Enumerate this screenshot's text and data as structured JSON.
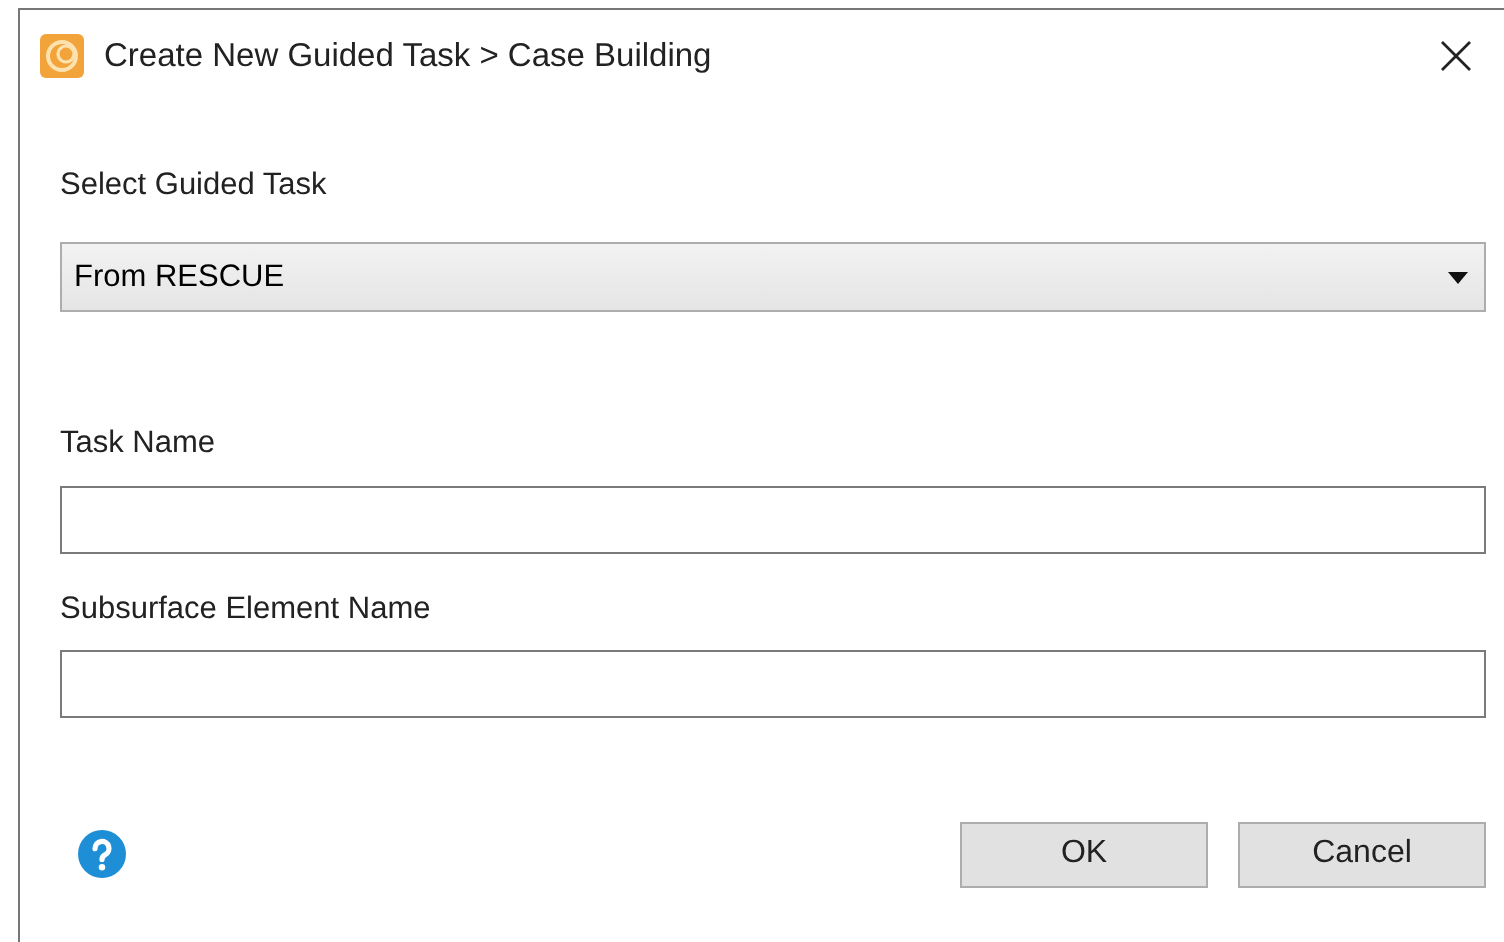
{
  "window": {
    "title": "Create New Guided Task > Case Building"
  },
  "guided_task": {
    "label": "Select Guided Task",
    "value": "From RESCUE"
  },
  "fields": [
    {
      "label": "Task Name"
    },
    {
      "label": "Subsurface Element Name"
    }
  ],
  "buttons": [
    "OK",
    "Cancel"
  ]
}
